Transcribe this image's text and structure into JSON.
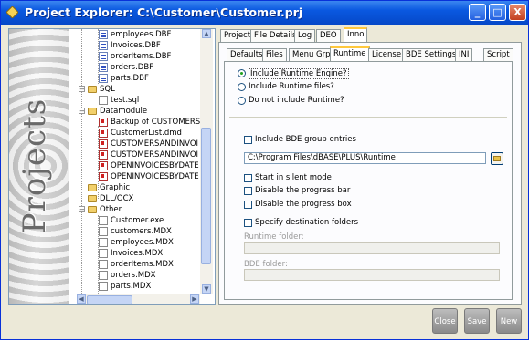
{
  "window": {
    "title": "Project Explorer: C:\\Customer\\Customer.prj",
    "buttons": [
      "_",
      "□",
      "X"
    ]
  },
  "banner": {
    "text": "Projects"
  },
  "tree": {
    "items": [
      {
        "label": "employees.DBF",
        "icon": "dbf-file-icon"
      },
      {
        "label": "Invoices.DBF",
        "icon": "dbf-file-icon"
      },
      {
        "label": "orderItems.DBF",
        "icon": "dbf-file-icon"
      },
      {
        "label": "orders.DBF",
        "icon": "dbf-file-icon"
      },
      {
        "label": "parts.DBF",
        "icon": "dbf-file-icon"
      },
      {
        "label": "SQL",
        "icon": "folder-icon"
      },
      {
        "label": "test.sql",
        "icon": "sql-file-icon"
      },
      {
        "label": "Datamodule",
        "icon": "folder-icon"
      },
      {
        "label": "Backup of CUSTOMERS",
        "icon": "datamodule-file-icon"
      },
      {
        "label": "CustomerList.dmd",
        "icon": "datamodule-file-icon"
      },
      {
        "label": "CUSTOMERSANDINVOI",
        "icon": "datamodule-file-icon"
      },
      {
        "label": "CUSTOMERSANDINVOI",
        "icon": "datamodule-file-icon"
      },
      {
        "label": "OPENINVOICESBYDATE",
        "icon": "datamodule-file-icon"
      },
      {
        "label": "OPENINVOICESBYDATE",
        "icon": "datamodule-file-icon"
      },
      {
        "label": "Graphic",
        "icon": "folder-icon"
      },
      {
        "label": "DLL/OCX",
        "icon": "folder-icon"
      },
      {
        "label": "Other",
        "icon": "folder-icon"
      },
      {
        "label": "Customer.exe",
        "icon": "exe-file-icon"
      },
      {
        "label": "customers.MDX",
        "icon": "mdx-file-icon"
      },
      {
        "label": "employees.MDX",
        "icon": "mdx-file-icon"
      },
      {
        "label": "Invoices.MDX",
        "icon": "mdx-file-icon"
      },
      {
        "label": "orderItems.MDX",
        "icon": "mdx-file-icon"
      },
      {
        "label": "orders.MDX",
        "icon": "mdx-file-icon"
      },
      {
        "label": "parts.MDX",
        "icon": "mdx-file-icon"
      }
    ]
  },
  "outer_tabs": [
    "Project",
    "File Details",
    "Log",
    "DEO",
    "Inno"
  ],
  "inner_tabs": [
    "Defaults",
    "Files",
    "Menu Grp",
    "Runtime",
    "License",
    "BDE Settings",
    "INI",
    "Script"
  ],
  "runtime": {
    "radio": [
      "Include Runtime Engine?",
      "Include Runtime files?",
      "Do not include Runtime?"
    ],
    "include_bde": "Include BDE group entries",
    "path_value": "C:\\Program Files\\dBASE\\PLUS\\Runtime",
    "silent": "Start in silent mode",
    "disable_progress_bar": "Disable the progress bar",
    "disable_progress_box": "Disable the progress box",
    "specify_dest": "Specify destination folders",
    "runtime_folder_label": "Runtime folder:",
    "bde_folder_label": "BDE folder:"
  },
  "bottom_buttons": {
    "close": "Close",
    "save": "Save",
    "new": "New"
  }
}
